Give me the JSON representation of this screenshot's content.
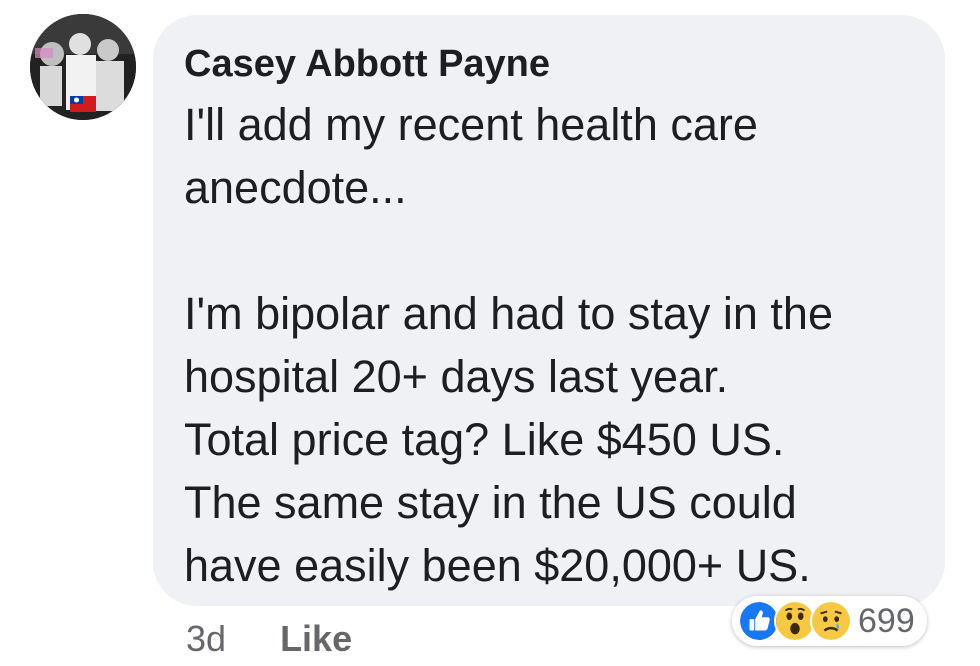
{
  "comment": {
    "author": "Casey Abbott Payne",
    "lines": [
      "I'll add my recent health care",
      "anecdote...",
      "",
      "I'm bipolar and had to stay in the",
      "hospital 20+ days last year.",
      "Total price tag? Like $450 US.",
      "The same stay in the US could",
      "have easily been $20,000+ US."
    ],
    "timestamp": "3d",
    "like_label": "Like"
  },
  "reactions": {
    "icons": [
      "like-reaction-icon",
      "wow-reaction-icon",
      "sad-reaction-icon"
    ],
    "count": "699"
  },
  "colors": {
    "bubble": "#f0f1f4",
    "like_blue": "#1877f2",
    "emoji_yellow": "#f7c843"
  }
}
